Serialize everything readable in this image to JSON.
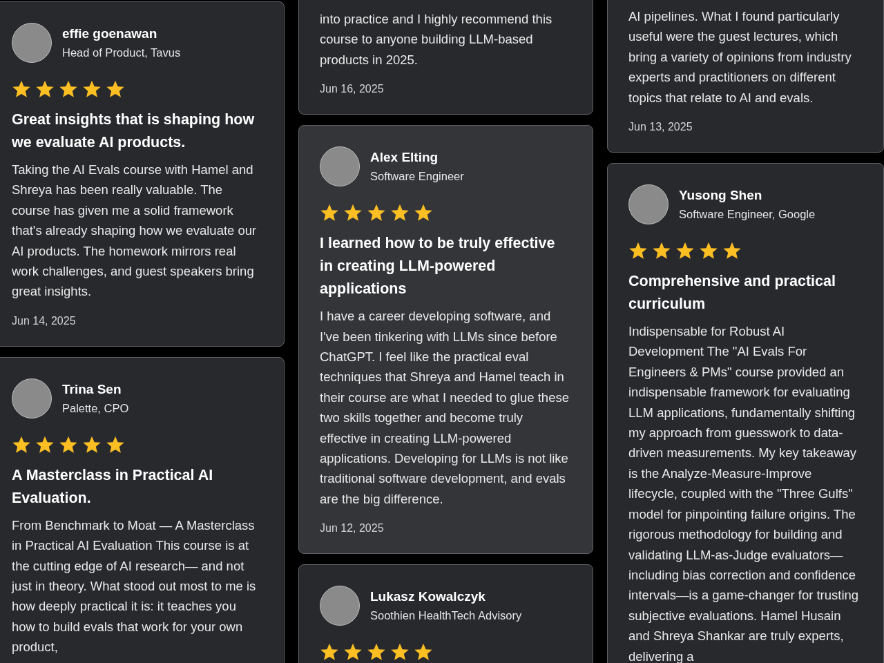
{
  "columns": [
    {
      "cards": [
        {
          "hovered": false,
          "name": "effie goenawan",
          "role": "Head of Product, Tavus",
          "stars": 5,
          "title": "Great insights that is shaping how we evaluate AI products.",
          "body": "Taking the AI Evals course with Hamel and Shreya has been really valuable. The course has given me a solid framework that's already shaping how we evaluate our AI products. The homework mirrors real work challenges, and guest speakers bring great insights.",
          "date": "Jun 14, 2025"
        },
        {
          "hovered": false,
          "name": "Trina Sen",
          "role": "Palette, CPO",
          "stars": 5,
          "title": "A Masterclass in Practical AI Evaluation.",
          "body": "From Benchmark to Moat — A Masterclass in Practical AI Evaluation This course is at the cutting edge of AI research— and not just in theory. What stood out most to me is how deeply practical it is: it teaches you how to build evals that work for your own product,"
        }
      ]
    },
    {
      "cards": [
        {
          "hovered": false,
          "body": "into practice and I highly recommend this course to anyone building LLM-based products in 2025.",
          "date": "Jun 16, 2025"
        },
        {
          "hovered": true,
          "name": "Alex Elting",
          "role": "Software Engineer",
          "stars": 5,
          "title": "I learned how to be truly effective in creating LLM-powered applications",
          "body": "I have a career developing software, and I've been tinkering with LLMs since before ChatGPT. I feel like the practical eval techniques that Shreya and Hamel teach in their course are what I needed to glue these two skills together and become truly effective in creating LLM-powered applications. Developing for LLMs is not like traditional software development, and evals are the big difference.",
          "date": "Jun 12, 2025"
        },
        {
          "hovered": false,
          "name": "Lukasz Kowalczyk",
          "role": "Soothien HealthTech Advisory",
          "stars": 5
        }
      ]
    },
    {
      "cards": [
        {
          "hovered": false,
          "body": "AI pipelines. What I found particularly useful were the guest lectures, which bring a variety of opinions from industry experts and practitioners on different topics that relate to AI and evals.",
          "date": "Jun 13, 2025"
        },
        {
          "hovered": false,
          "name": "Yusong Shen",
          "role": "Software Engineer, Google",
          "stars": 5,
          "title": "Comprehensive and practical curriculum",
          "body": "Indispensable for Robust AI Development The \"AI Evals For Engineers & PMs\" course provided an indispensable framework for evaluating LLM applications, fundamentally shifting my approach from guesswork to data-driven measurements. My key takeaway is the Analyze-Measure-Improve lifecycle, coupled with the \"Three Gulfs\" model for pinpointing failure origins. The rigorous methodology for building and validating LLM-as-Judge evaluators—including bias correction and confidence intervals—is a game-changer for trusting subjective evaluations. Hamel Husain and Shreya Shankar are truly experts, delivering a"
        }
      ]
    }
  ]
}
